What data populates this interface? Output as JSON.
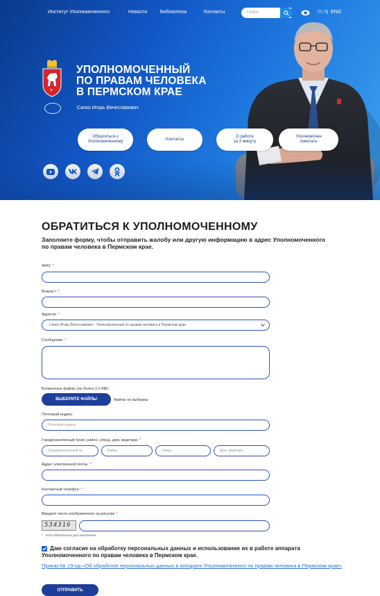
{
  "topnav": {
    "links": [
      "Институт Уполномоченного",
      "Новости",
      "Библиотека",
      "Контакты"
    ],
    "search_placeholder": "Поиск",
    "lang_ru": "RUS",
    "lang_sep": "|",
    "lang_en": "ENG"
  },
  "hero": {
    "title_lines": [
      "УПОЛНОМОЧЕННЫЙ",
      "ПО ПРАВАМ ЧЕЛОВЕКА",
      "В ПЕРМСКОМ КРАЕ"
    ],
    "subtitle": "Сапко Игорь Вячеславович",
    "buttons": [
      {
        "line1": "Обратиться к",
        "line2": "Уполномоченному"
      },
      {
        "line1": "Контакты",
        "line2": ""
      },
      {
        "line1": "О работе",
        "line2": "за 1 минуту"
      },
      {
        "line1": "Уполномочен",
        "line2": "помогать"
      }
    ],
    "social": [
      "youtube-icon",
      "vk-icon",
      "telegram-icon",
      "odnoklassniki-icon"
    ]
  },
  "form": {
    "title": "ОБРАТИТЬСЯ К УПОЛНОМОЧЕННОМУ",
    "intro": "Заполните форму, чтобы отправить жалобу или другую информацию в адрес Уполномоченного по правам человека в Пермском крае.",
    "labels": {
      "fio": "ФИО:",
      "age": "Возраст:",
      "addressee": "Адресат:",
      "message": "Сообщение:",
      "attachments": "Вложенные файлы (не более 2,0 МБ):",
      "postal": "Почтовый индекс:",
      "address": "Город/населенный пункт, район, улица, дом, квартира:",
      "email": "Адрес электронной почты:",
      "phone": "Контактный телефон:",
      "captcha": "Введите число изображенное на рисунке"
    },
    "required_mark": "*",
    "addressee_value": "Сапко Игорь Вячеславович - Уполномоченный по правам человека в Пермском крае",
    "file_button": "ВЫБЕРИТЕ ФАЙЛЫ",
    "file_status": "Файлы не выбраны",
    "postal_placeholder": "Почтовый индекс",
    "address_placeholders": [
      "Город/населенный пу",
      "Район",
      "Улица",
      "Дом, квартира"
    ],
    "captcha_code": "534316",
    "required_note": "* - поля обязательны для заполнения",
    "consent": "Даю согласие на обработку персональных данных и использование их в работе аппарата Уполномоченного по правам человека в Пермском крае.",
    "consent_link": "Приказ № 19-од «Об обработке персональных данных в аппарате Уполномоченного по правам человека в Пермском крае»",
    "submit": "ОТПРАВИТЬ"
  }
}
